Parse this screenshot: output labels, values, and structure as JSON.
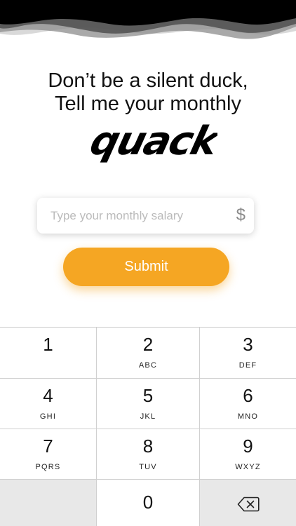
{
  "header": {
    "line1": "Don’t be a silent duck,",
    "line2": "Tell me your monthly",
    "logo_word": "quack"
  },
  "salary": {
    "value": "",
    "placeholder": "Type your monthly salary",
    "currency_symbol": "$"
  },
  "submit": {
    "label": "Submit"
  },
  "keypad": {
    "keys": [
      {
        "digit": "1",
        "letters": ""
      },
      {
        "digit": "2",
        "letters": "ABC"
      },
      {
        "digit": "3",
        "letters": "DEF"
      },
      {
        "digit": "4",
        "letters": "GHI"
      },
      {
        "digit": "5",
        "letters": "JKL"
      },
      {
        "digit": "6",
        "letters": "MNO"
      },
      {
        "digit": "7",
        "letters": "PQRS"
      },
      {
        "digit": "8",
        "letters": "TUV"
      },
      {
        "digit": "9",
        "letters": "WXYZ"
      }
    ],
    "zero": "0",
    "delete_icon": "backspace-icon"
  },
  "colors": {
    "accent": "#f5a623",
    "header_wave": "#000000",
    "keypad_gray": "#e8e8e8"
  }
}
